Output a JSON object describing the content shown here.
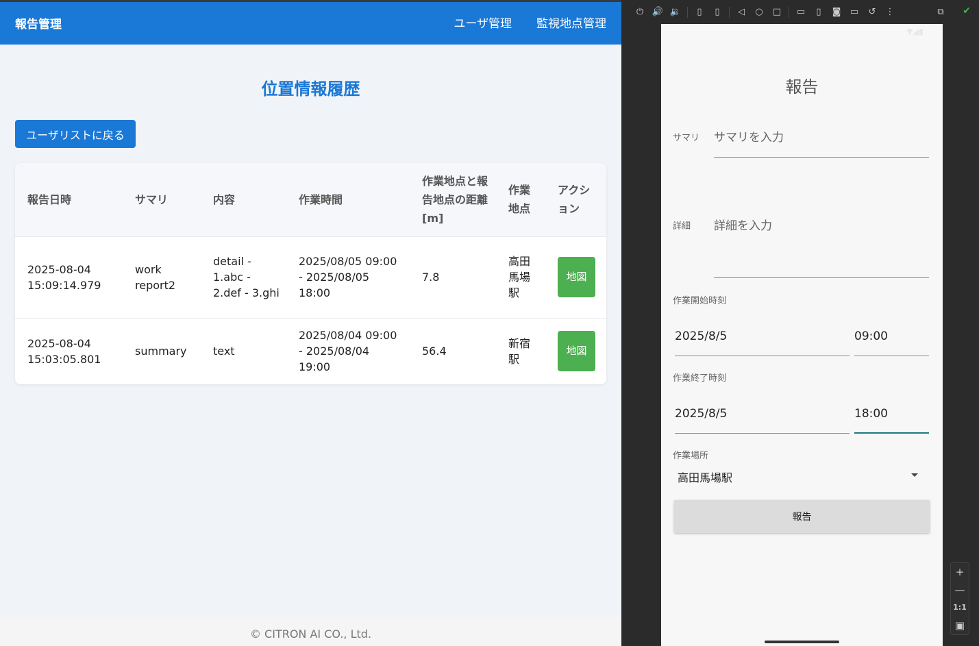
{
  "web": {
    "brand": "報告管理",
    "nav": [
      "ユーザ管理",
      "監視地点管理"
    ],
    "page_title": "位置情報履歴",
    "back_button": "ユーザリストに戻る",
    "table": {
      "headers": [
        "報告日時",
        "サマリ",
        "内容",
        "作業時間",
        "作業地点と報告地点の距離[m]",
        "作業地点",
        "アクション"
      ],
      "rows": [
        {
          "datetime": "2025-08-04 15:09:14.979",
          "summary": "work report2",
          "content": "detail - 1.abc - 2.def - 3.ghi",
          "work_time": "2025/08/05 09:00 - 2025/08/05 18:00",
          "distance": "7.8",
          "location": "高田馬場駅",
          "action": "地図"
        },
        {
          "datetime": "2025-08-04 15:03:05.801",
          "summary": "summary",
          "content": "text",
          "work_time": "2025/08/04 09:00 - 2025/08/04 19:00",
          "distance": "56.4",
          "location": "新宿駅",
          "action": "地図"
        }
      ]
    },
    "footer": "© CITRON AI CO., Ltd."
  },
  "app": {
    "title": "報告",
    "summary_label": "サマリ",
    "summary_placeholder": "サマリを入力",
    "detail_label": "詳細",
    "detail_placeholder": "詳細を入力",
    "start_label": "作業開始時刻",
    "start_date": "2025/8/5",
    "start_time": "09:00",
    "end_label": "作業終了時刻",
    "end_date": "2025/8/5",
    "end_time": "18:00",
    "place_label": "作業場所",
    "place_value": "高田馬場駅",
    "submit": "報告"
  },
  "emulator": {
    "zoom_one_to_one": "1:1"
  },
  "colors": {
    "primary": "#1a78d6",
    "map_button": "#4caf50",
    "focus_underline": "#1f7a80"
  }
}
